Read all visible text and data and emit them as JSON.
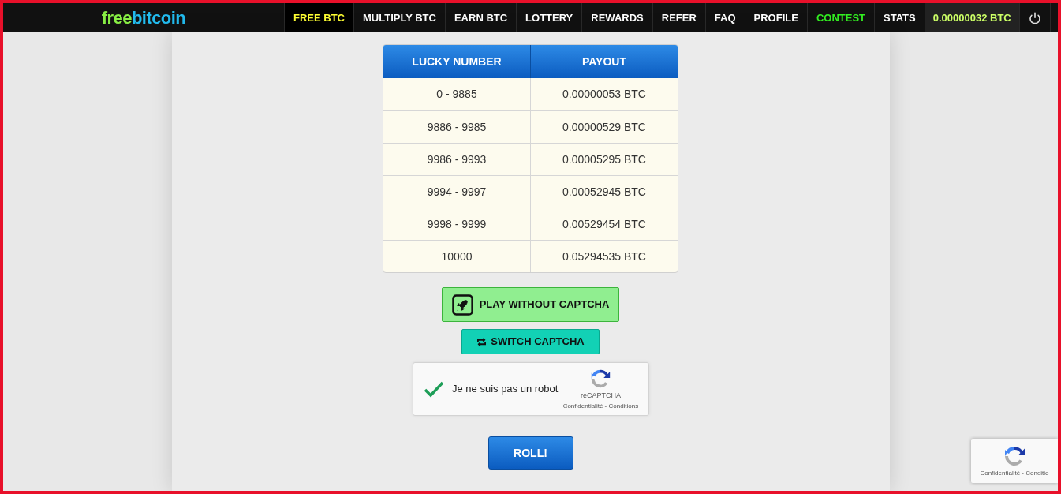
{
  "logo": {
    "part1": "free",
    "part2": "bitcoin"
  },
  "nav": [
    {
      "label": "FREE BTC",
      "selected": true,
      "kind": "normal"
    },
    {
      "label": "MULTIPLY BTC",
      "selected": false,
      "kind": "normal"
    },
    {
      "label": "EARN BTC",
      "selected": false,
      "kind": "normal"
    },
    {
      "label": "LOTTERY",
      "selected": false,
      "kind": "normal"
    },
    {
      "label": "REWARDS",
      "selected": false,
      "kind": "normal"
    },
    {
      "label": "REFER",
      "selected": false,
      "kind": "normal"
    },
    {
      "label": "FAQ",
      "selected": false,
      "kind": "normal"
    },
    {
      "label": "PROFILE",
      "selected": false,
      "kind": "normal"
    },
    {
      "label": "CONTEST",
      "selected": false,
      "kind": "contest"
    },
    {
      "label": "STATS",
      "selected": false,
      "kind": "normal"
    }
  ],
  "balance": "0.00000032 BTC",
  "table": {
    "columns": [
      "LUCKY NUMBER",
      "PAYOUT"
    ],
    "rows": [
      [
        "0 - 9885",
        "0.00000053 BTC"
      ],
      [
        "9886 - 9985",
        "0.00000529 BTC"
      ],
      [
        "9986 - 9993",
        "0.00005295 BTC"
      ],
      [
        "9994 - 9997",
        "0.00052945 BTC"
      ],
      [
        "9998 - 9999",
        "0.00529454 BTC"
      ],
      [
        "10000",
        "0.05294535 BTC"
      ]
    ]
  },
  "play_button": "PLAY WITHOUT CAPTCHA",
  "switch_button": "SWITCH CAPTCHA",
  "recaptcha": {
    "checked": true,
    "label": "Je ne suis pas un robot",
    "brand": "reCAPTCHA",
    "links": "Confidentialité - Conditions"
  },
  "roll_button": "ROLL!",
  "recaptcha_badge": {
    "links": "Confidentialité - Conditio"
  }
}
